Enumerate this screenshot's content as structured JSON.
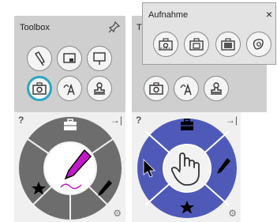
{
  "toolbox": {
    "title": "Toolbox"
  },
  "toolbox2": {
    "title": "T"
  },
  "popup": {
    "title": "Aufnahme",
    "close": "×"
  },
  "wheel": {
    "help": "?",
    "dock": "→|",
    "settings": "⚙"
  },
  "colors": {
    "panel_gray": "#cfcfcf",
    "wheel_gray": "#6d6d6d",
    "wheel_blue": "#4f5ab8",
    "active_ring": "#2aa7bf",
    "pen_magenta": "#c417c9"
  },
  "icons": {
    "toolbox_buttons": [
      "flashlight-icon",
      "screen-icon",
      "presentation-icon",
      "camera-icon",
      "text-recognition-icon",
      "stamp-icon"
    ],
    "popup_buttons": [
      "screenshot-region-icon",
      "screenshot-window-icon",
      "screenshot-screen-icon",
      "screenshot-freehand-icon"
    ]
  }
}
